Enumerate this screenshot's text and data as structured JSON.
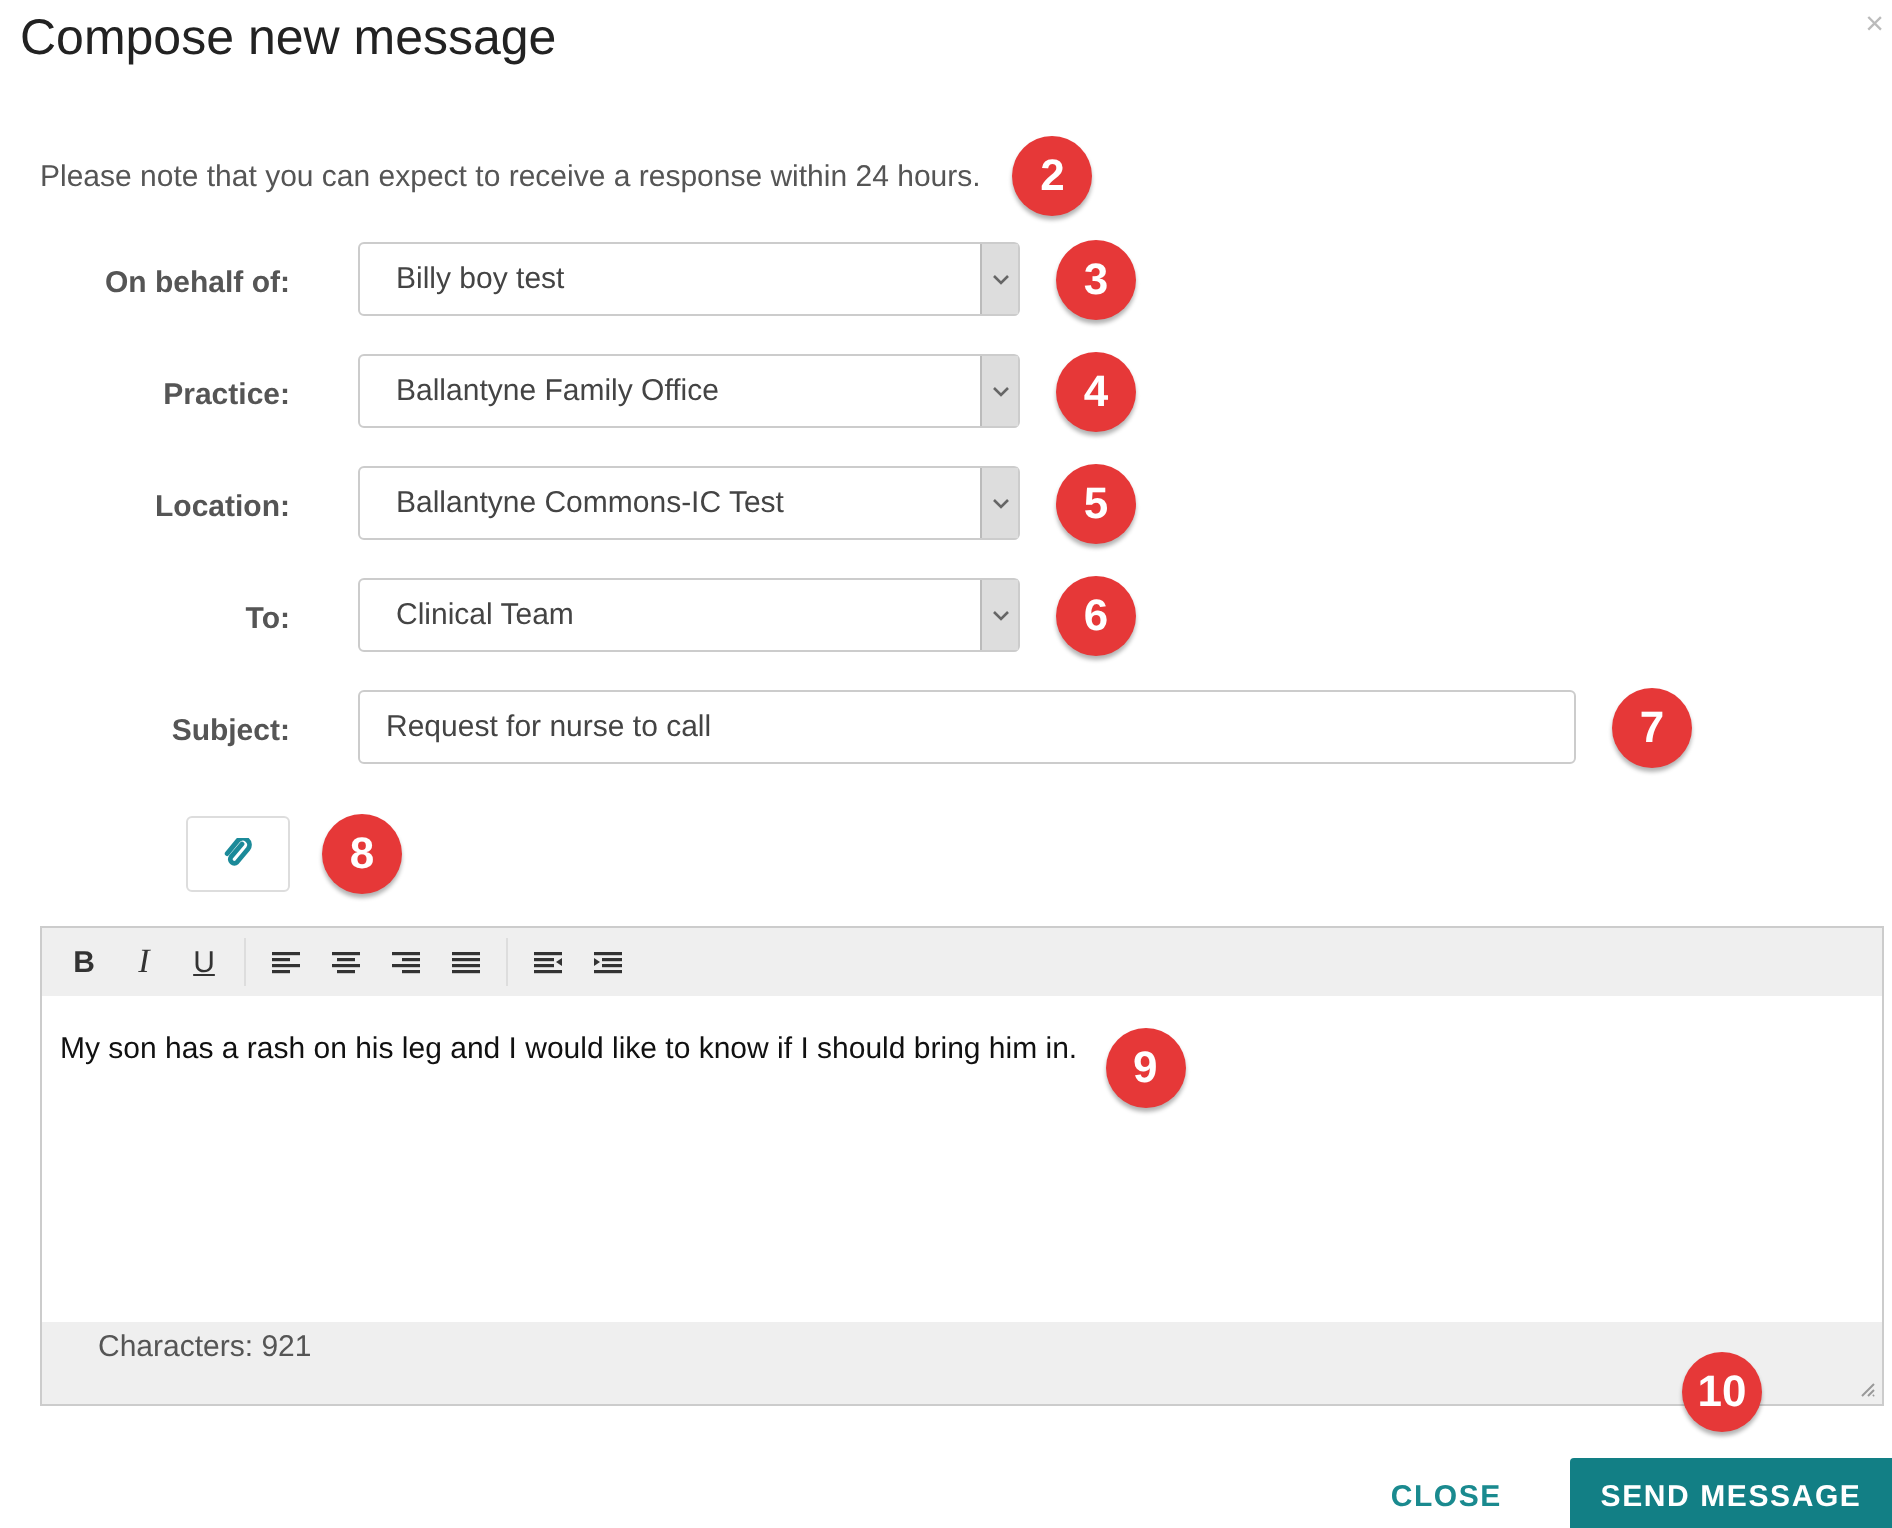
{
  "dialog": {
    "title": "Compose new message",
    "close": "×"
  },
  "note": {
    "text": "Please note that you can expect to receive a response within 24 hours.",
    "callout": "2"
  },
  "fields": [
    {
      "kind": "select",
      "label": "On behalf of:",
      "value": "Billy boy test",
      "callout": "3"
    },
    {
      "kind": "select",
      "label": "Practice:",
      "value": "Ballantyne Family Office",
      "callout": "4"
    },
    {
      "kind": "select",
      "label": "Location:",
      "value": "Ballantyne Commons-IC Test",
      "callout": "5"
    },
    {
      "kind": "select",
      "label": "To:",
      "value": "Clinical Team",
      "callout": "6"
    },
    {
      "kind": "text",
      "label": "Subject:",
      "value": "Request for nurse to call",
      "callout": "7"
    }
  ],
  "attach": {
    "callout": "8"
  },
  "editor": {
    "toolbar": [
      {
        "kind": "bold",
        "label": "B"
      },
      {
        "kind": "italic",
        "label": "I"
      },
      {
        "kind": "underline",
        "label": "U"
      },
      {
        "kind": "align-left"
      },
      {
        "kind": "align-center"
      },
      {
        "kind": "align-right"
      },
      {
        "kind": "justify"
      },
      {
        "kind": "outdent"
      },
      {
        "kind": "indent"
      }
    ],
    "body": "My son has a rash on his leg and I would like to know if I should bring him in.",
    "callout": "9",
    "characters": "Characters: 921"
  },
  "buttons": [
    {
      "kind": "flat",
      "label": "CLOSE"
    },
    {
      "kind": "primary",
      "label": "SEND MESSAGE",
      "callout": "10"
    }
  ]
}
